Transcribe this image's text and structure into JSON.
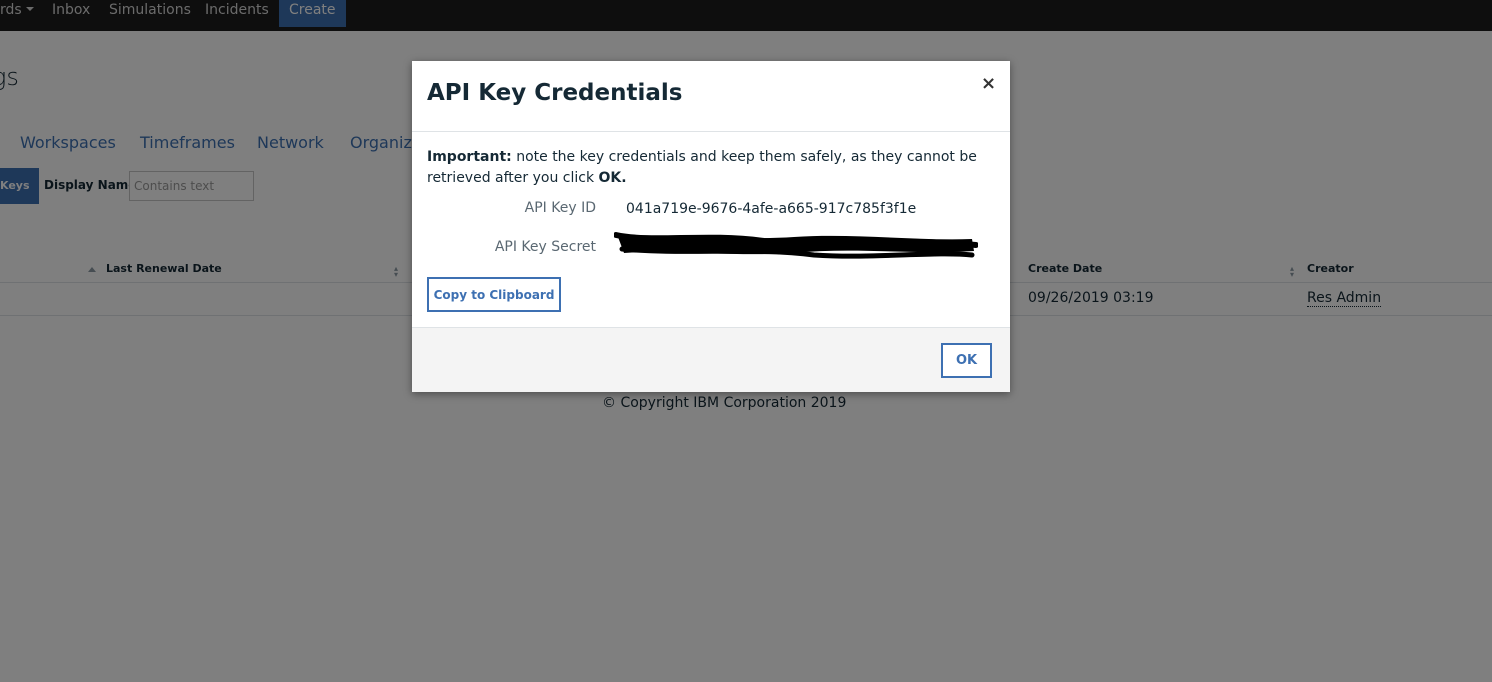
{
  "nav": {
    "items": [
      "rds",
      "Inbox",
      "Simulations",
      "Incidents"
    ],
    "active": "Create"
  },
  "page": {
    "title": "gs"
  },
  "tabs": [
    "Workspaces",
    "Timeframes",
    "Network",
    "Organiza"
  ],
  "filter": {
    "keys_button": "Keys",
    "display_name_label": "Display Name:",
    "display_name_placeholder": "Contains text"
  },
  "table": {
    "columns": [
      "Last Renewal Date",
      "Create Date",
      "Creator"
    ],
    "rows": [
      {
        "create_date": "09/26/2019 03:19",
        "creator": "Res Admin"
      }
    ]
  },
  "footer": {
    "copyright": "© Copyright IBM Corporation 2019"
  },
  "modal": {
    "title": "API Key Credentials",
    "close": "×",
    "important_label": "Important:",
    "important_text": " note the key credentials and keep them safely, as they cannot be retrieved after you click ",
    "important_ok": "OK.",
    "key_id_label": "API Key ID",
    "key_id_value": "041a719e-9676-4afe-a665-917c785f3f1e",
    "key_secret_label": "API Key Secret",
    "copy_button": "Copy to Clipboard",
    "ok_button": "OK"
  }
}
